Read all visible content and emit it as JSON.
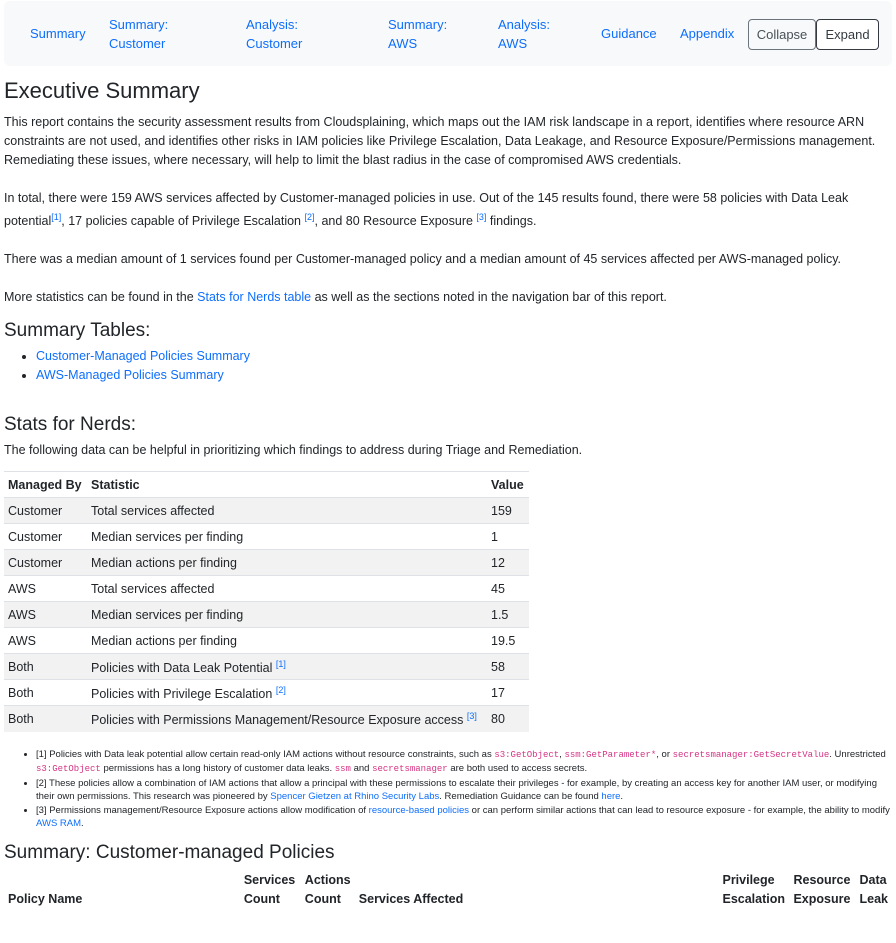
{
  "nav": {
    "links": [
      "Summary",
      "Summary: Customer",
      "Analysis: Customer",
      "Summary: AWS",
      "Analysis: AWS",
      "Guidance",
      "Appendix"
    ],
    "collapse_label": "Collapse",
    "expand_label": "Expand"
  },
  "executive": {
    "title": "Executive Summary",
    "p1": "This report contains the security assessment results from Cloudsplaining, which maps out the IAM risk landscape in a report, identifies where resource ARN constraints are not used, and identifies other risks in IAM policies like Privilege Escalation, Data Leakage, and Resource Exposure/Permissions management. Remediating these issues, where necessary, will help to limit the blast radius in the case of compromised AWS credentials.",
    "p2_a": "In total, there were 159 AWS services affected by Customer-managed policies in use. Out of the 145 results found, there were 58 policies with Data Leak potential",
    "p2_ref1": "[1]",
    "p2_b": ", 17 policies capable of Privilege Escalation ",
    "p2_ref2": "[2]",
    "p2_c": ", and 80 Resource Exposure ",
    "p2_ref3": "[3]",
    "p2_d": " findings.",
    "p3": "There was a median amount of 1 services found per Customer-managed policy and a median amount of 45 services affected per AWS-managed policy.",
    "p4_a": "More statistics can be found in the ",
    "p4_link": "Stats for Nerds table",
    "p4_b": " as well as the sections noted in the navigation bar of this report."
  },
  "summary_tables": {
    "title": "Summary Tables:",
    "items": [
      "Customer-Managed Policies Summary",
      "AWS-Managed Policies Summary"
    ]
  },
  "stats": {
    "title": "Stats for Nerds:",
    "intro": "The following data can be helpful in prioritizing which findings to address during Triage and Remediation.",
    "headers": [
      "Managed By",
      "Statistic",
      "Value"
    ],
    "rows": [
      {
        "managed_by": "Customer",
        "statistic": "Total services affected",
        "ref": "",
        "value": "159"
      },
      {
        "managed_by": "Customer",
        "statistic": "Median services per finding",
        "ref": "",
        "value": "1"
      },
      {
        "managed_by": "Customer",
        "statistic": "Median actions per finding",
        "ref": "",
        "value": "12"
      },
      {
        "managed_by": "AWS",
        "statistic": "Total services affected",
        "ref": "",
        "value": "45"
      },
      {
        "managed_by": "AWS",
        "statistic": "Median services per finding",
        "ref": "",
        "value": "1.5"
      },
      {
        "managed_by": "AWS",
        "statistic": "Median actions per finding",
        "ref": "",
        "value": "19.5"
      },
      {
        "managed_by": "Both",
        "statistic": "Policies with Data Leak Potential",
        "ref": "[1]",
        "value": "58"
      },
      {
        "managed_by": "Both",
        "statistic": "Policies with Privilege Escalation",
        "ref": "[2]",
        "value": "17"
      },
      {
        "managed_by": "Both",
        "statistic": "Policies with Permissions Management/Resource Exposure access",
        "ref": "[3]",
        "value": "80"
      }
    ]
  },
  "notes": {
    "n1_a": "[1] Policies with Data leak potential allow certain read-only IAM actions without resource constraints, such as ",
    "n1_code1": "s3:GetObject",
    "n1_b": ", ",
    "n1_code2": "ssm:GetParameter*",
    "n1_c": ", or ",
    "n1_code3": "secretsmanager:GetSecretValue",
    "n1_d": ". Unrestricted ",
    "n1_code4": "s3:GetObject",
    "n1_e": " permissions has a long history of customer data leaks. ",
    "n1_code5": "ssm",
    "n1_f": " and ",
    "n1_code6": "secretsmanager",
    "n1_g": " are both used to access secrets.",
    "n2_a": "[2] These policies allow a combination of IAM actions that allow a principal with these permissions to escalate their privileges - for example, by creating an access key for another IAM user, or modifying their own permissions. This research was pioneered by ",
    "n2_link": "Spencer Gietzen at Rhino Security Labs",
    "n2_b": ". Remediation Guidance can be found ",
    "n2_link2": "here",
    "n2_c": ".",
    "n3_a": "[3] Permissions management/Resource Exposure actions allow modification of ",
    "n3_link": "resource-based policies",
    "n3_b": " or can perform similar actions that can lead to resource exposure - for example, the ability to modify ",
    "n3_link2": "AWS RAM",
    "n3_c": "."
  },
  "customer_summary": {
    "title": "Summary: Customer-managed Policies",
    "headers": [
      "Policy Name",
      "Services Count",
      "Actions Count",
      "Services Affected",
      "Privilege Escalation",
      "Resource Exposure",
      "Data Leak"
    ]
  }
}
